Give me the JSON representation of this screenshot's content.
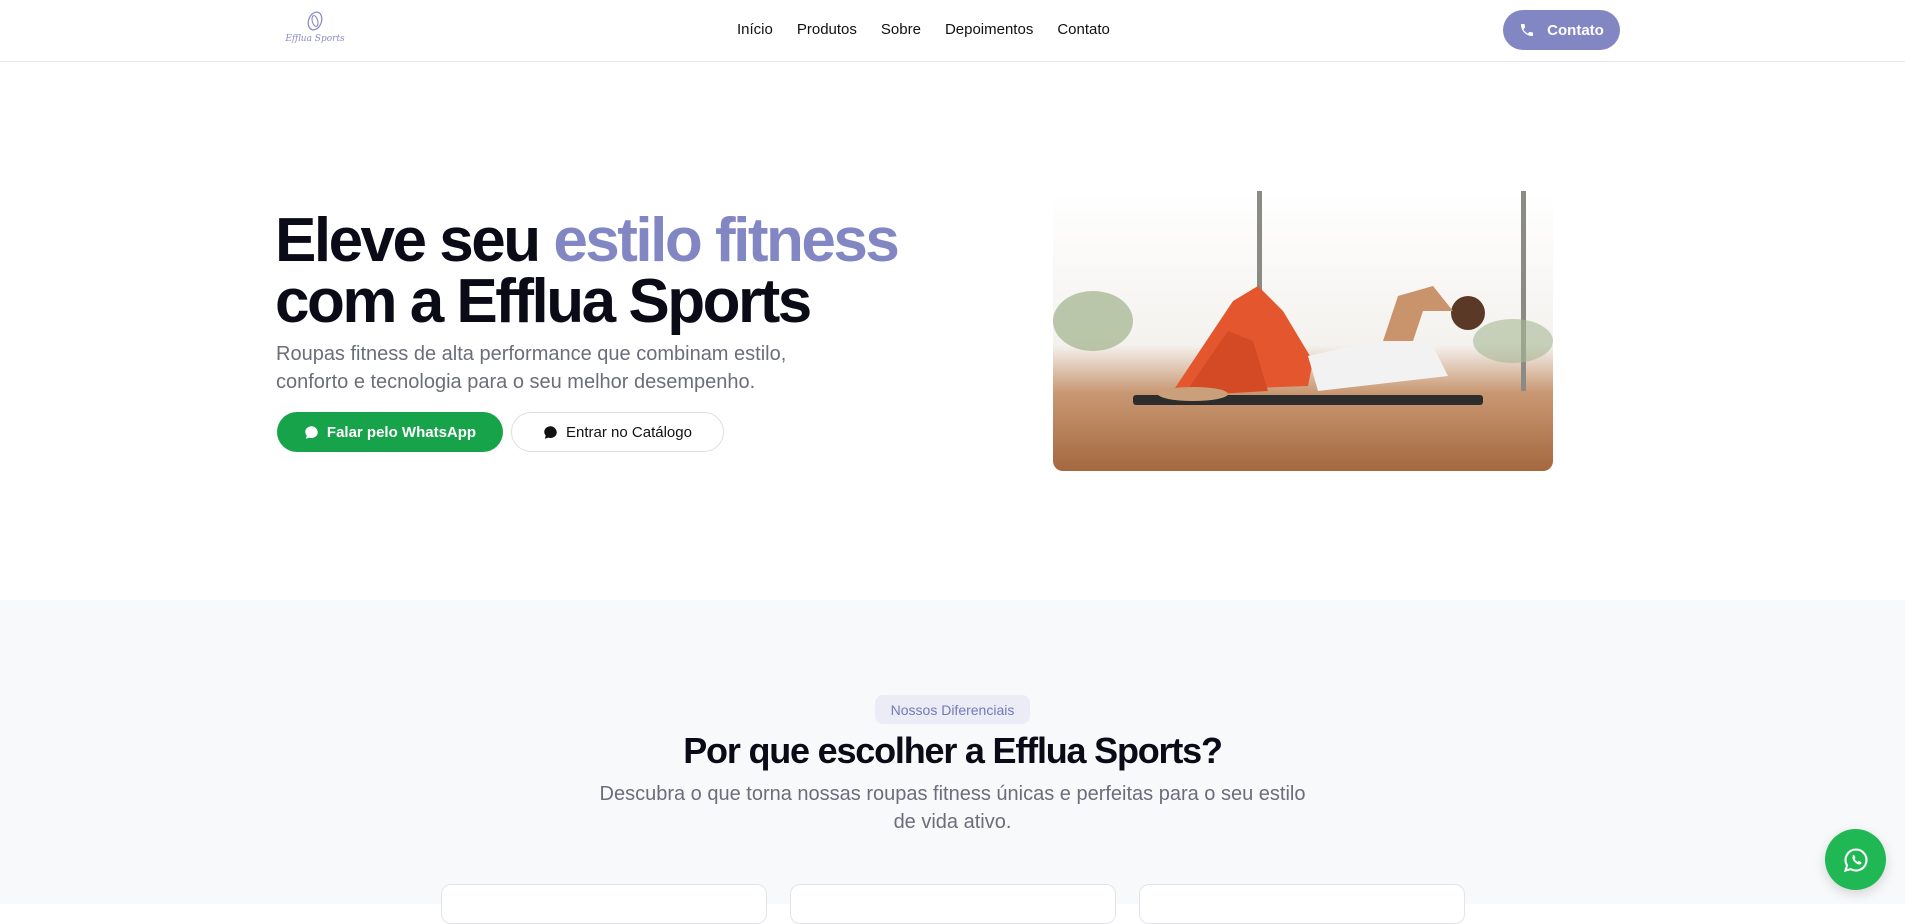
{
  "header": {
    "logo_text": "Efflua Sports",
    "nav": [
      "Início",
      "Produtos",
      "Sobre",
      "Depoimentos",
      "Contato"
    ],
    "contact_button": "Contato"
  },
  "hero": {
    "title_part1": "Eleve seu ",
    "title_accent": "estilo fitness",
    "title_part2": "com a Efflua Sports",
    "subtitle": "Roupas fitness de alta performance que combinam estilo, conforto e tecnologia para o seu melhor desempenho.",
    "whatsapp_button": "Falar pelo WhatsApp",
    "catalog_button": "Entrar no Catálogo"
  },
  "features": {
    "badge": "Nossos Diferenciais",
    "title": "Por que escolher a Efflua Sports?",
    "subtitle": "Descubra o que torna nossas roupas fitness únicas e perfeitas para o seu estilo de vida ativo."
  },
  "colors": {
    "accent": "#8287c4",
    "whatsapp": "#17a34a",
    "fab": "#1fb855"
  },
  "icons": {
    "contact": "phone-icon",
    "whatsapp_button": "chat-bubble-icon",
    "catalog_button": "chat-bubble-icon",
    "fab": "whatsapp-icon"
  }
}
